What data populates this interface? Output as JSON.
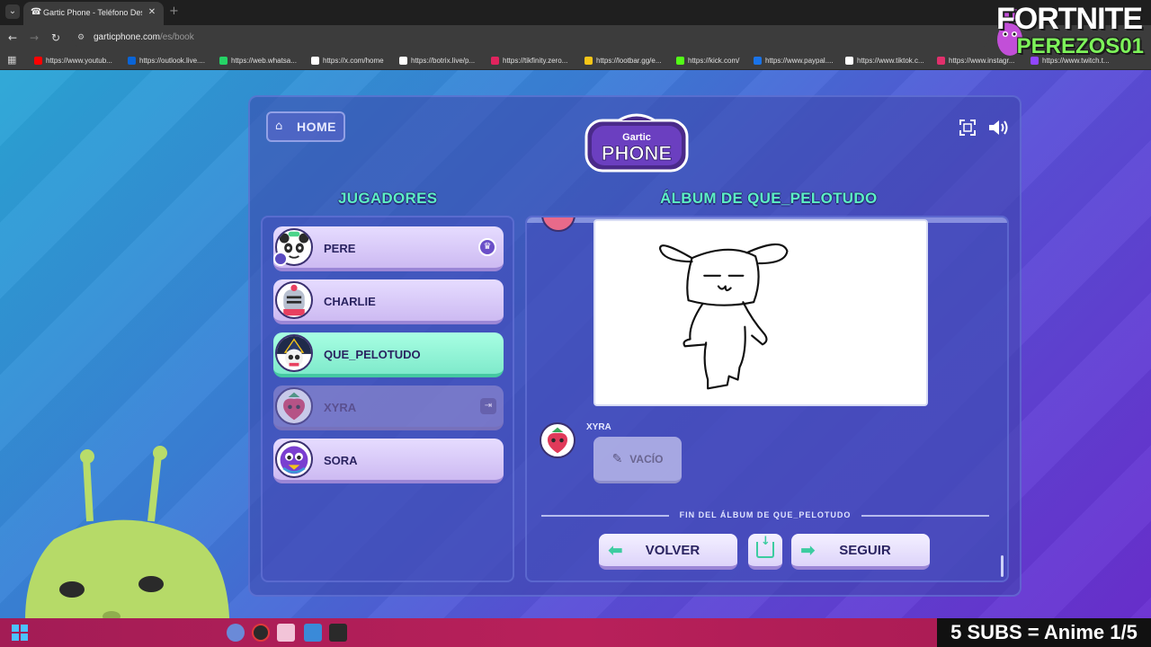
{
  "browser": {
    "tab_title": "Gartic Phone - Teléfono Descon",
    "url_domain": "garticphone.com",
    "url_path": "/es/book",
    "bookmarks": [
      {
        "label": "https://www.youtub...",
        "color": "#ff0000"
      },
      {
        "label": "https://outlook.live....",
        "color": "#0a64d6"
      },
      {
        "label": "https://web.whatsa...",
        "color": "#25d366"
      },
      {
        "label": "https://x.com/home",
        "color": "#ffffff"
      },
      {
        "label": "https://botrix.live/p...",
        "color": "#ffffff"
      },
      {
        "label": "https://tikfinity.zero...",
        "color": "#e0245e"
      },
      {
        "label": "https://lootbar.gg/e...",
        "color": "#f5c518"
      },
      {
        "label": "https://kick.com/",
        "color": "#53fc18"
      },
      {
        "label": "https://www.paypal....",
        "color": "#1a73e8"
      },
      {
        "label": "https://www.tiktok.c...",
        "color": "#ffffff"
      },
      {
        "label": "https://www.instagr...",
        "color": "#e1306c"
      },
      {
        "label": "https://www.twitch.t...",
        "color": "#9146ff"
      }
    ]
  },
  "game": {
    "home_label": "HOME",
    "logo_top": "Gartic",
    "logo_bottom": "PHONE",
    "players_title": "JUGADORES",
    "album_title": "ÁLBUM DE QUE_PELOTUDO",
    "players": [
      {
        "name": "PERE",
        "state": "host"
      },
      {
        "name": "CHARLIE",
        "state": "normal"
      },
      {
        "name": "QUE_PELOTUDO",
        "state": "active"
      },
      {
        "name": "XYRA",
        "state": "left"
      },
      {
        "name": "SORA",
        "state": "normal"
      }
    ],
    "album": {
      "entry_author": "XYRA",
      "empty_label": "VACÍO",
      "end_text": "FIN DEL ÁLBUM DE QUE_PELOTUDO"
    },
    "buttons": {
      "back": "VOLVER",
      "next": "SEGUIR"
    }
  },
  "overlay": {
    "fortnite_title": "FORTNITE",
    "channel_name": "PEREZOS01",
    "subs_banner": "5 SUBS = Anime 1/5"
  },
  "colors": {
    "accent": "#5cf0c4",
    "active_player": "#7feacb",
    "player_card": "#cdbaf2"
  }
}
